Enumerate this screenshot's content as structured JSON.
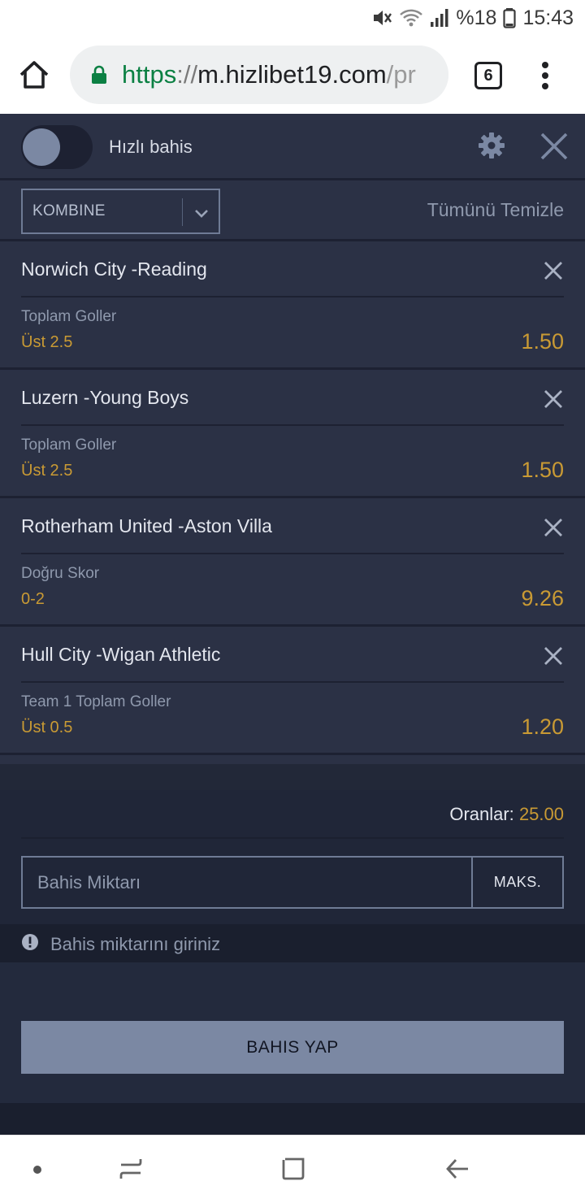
{
  "status_bar": {
    "battery": "%18",
    "time": "15:43"
  },
  "browser": {
    "url_scheme": "https",
    "url_sep": "://",
    "url_host": "m.hizlibet19.com",
    "url_path": "/pr",
    "tab_count": "6"
  },
  "betslip": {
    "quick_bet_label": "Hızlı bahis",
    "quick_bet_enabled": false,
    "bet_type": "KOMBINE",
    "clear_all": "Tümünü Temizle",
    "items": [
      {
        "match": "Norwich City -Reading",
        "market": "Toplam Goller",
        "pick": "Üst 2.5",
        "odd": "1.50"
      },
      {
        "match": "Luzern -Young Boys",
        "market": "Toplam Goller",
        "pick": "Üst 2.5",
        "odd": "1.50"
      },
      {
        "match": "Rotherham United -Aston Villa",
        "market": "Doğru Skor",
        "pick": "0-2",
        "odd": "9.26"
      },
      {
        "match": "Hull City -Wigan Athletic",
        "market": "Team 1 Toplam Goller",
        "pick": "Üst 0.5",
        "odd": "1.20"
      }
    ],
    "total_odds_label": "Oranlar:",
    "total_odds_value": "25.00",
    "stake_placeholder": "Bahis Miktarı",
    "max_button": "MAKS.",
    "warning": "Bahis miktarını giriniz",
    "place_bet": "BAHIS YAP"
  },
  "colors": {
    "panel": "#2b3145",
    "accent_gold": "#c99a34",
    "button": "#7b88a3",
    "secure_green": "#0b8043"
  },
  "icons": [
    "mute-icon",
    "wifi-icon",
    "signal-icon",
    "battery-icon",
    "home-icon",
    "lock-icon",
    "menu-dots-icon",
    "gear-icon",
    "close-icon",
    "chevron-down-icon",
    "alert-icon",
    "recent-apps-icon",
    "nav-home-icon",
    "back-icon"
  ]
}
